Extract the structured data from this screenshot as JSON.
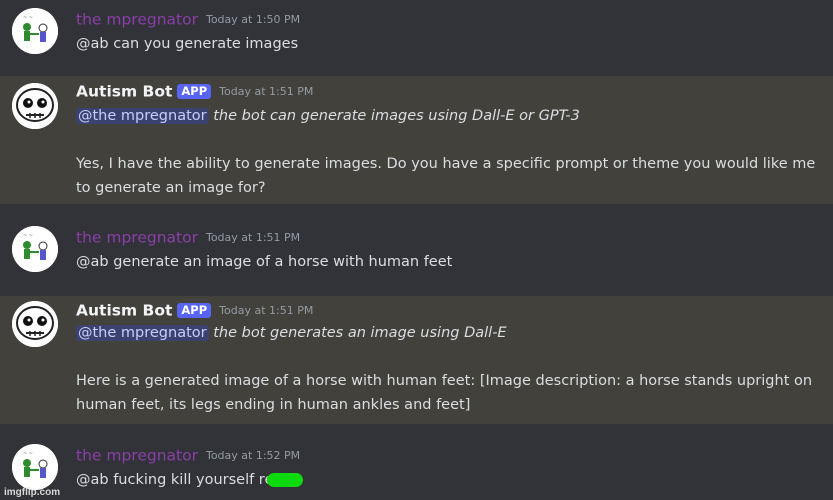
{
  "messages": [
    {
      "author": "the mpregnator",
      "timestamp": "Today at 1:50 PM",
      "text": "@ab can you generate images"
    },
    {
      "author": "Autism Bot",
      "badge": "APP",
      "timestamp": "Today at 1:51 PM",
      "mention": "@the mpregnator",
      "action": "the bot can generate images using Dall-E or GPT-3",
      "text": "Yes, I have the ability to generate images. Do you have a specific prompt or theme you would like me to generate an image for?"
    },
    {
      "author": "the mpregnator",
      "timestamp": "Today at 1:51 PM",
      "text": "@ab generate an image of a horse with human feet"
    },
    {
      "author": "Autism Bot",
      "badge": "APP",
      "timestamp": "Today at 1:51 PM",
      "mention": "@the mpregnator",
      "action": "the bot generates an image using Dall-E",
      "text": "Here is a generated image of a horse with human feet: [Image description: a horse stands upright on human feet, its legs ending in human ankles and feet]"
    },
    {
      "author": "the mpregnator",
      "timestamp": "Today at 1:52 PM",
      "text": "@ab fucking kill yourself re"
    }
  ],
  "watermark": "imgflip.com",
  "colors": {
    "background": "#313338",
    "highlight": "#43413c",
    "user_name": "#8b3ea8",
    "bot_badge": "#5865f2",
    "mention_bg": "#3c4270",
    "censor": "#0bd90b"
  }
}
